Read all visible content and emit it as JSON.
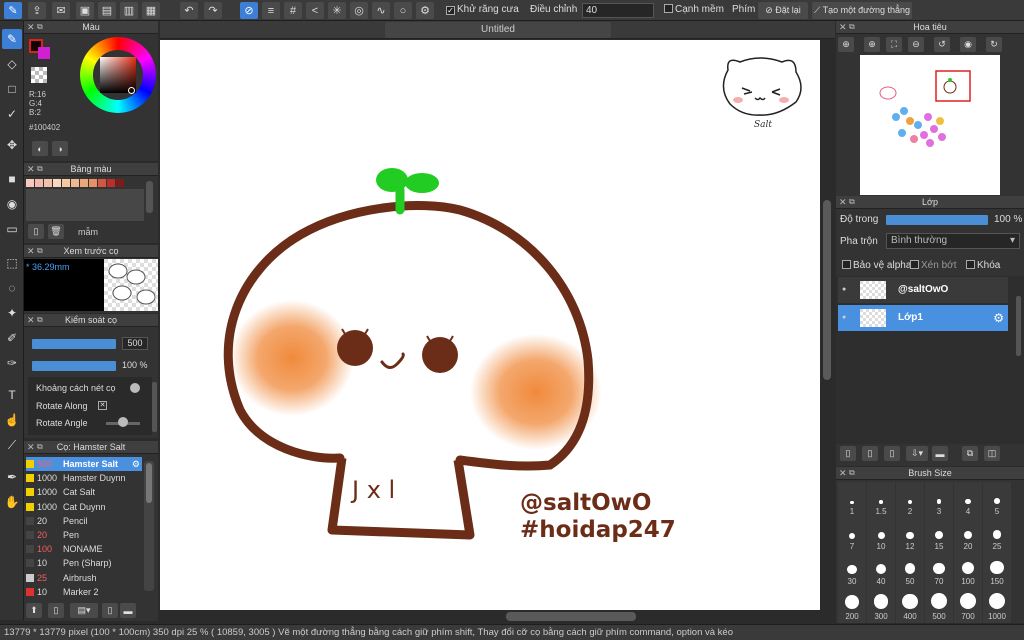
{
  "toolbar": {
    "antialias_label": "Khử răng cưa",
    "adjust_label": "Điều chỉnh",
    "adjust_value": "40",
    "edge_label": "Cạnh mềm",
    "key_label": "Phím",
    "reset_label": "Đặt lại",
    "straight_line_label": "Tạo một đường thẳng"
  },
  "document": {
    "tab_title": "Untitled"
  },
  "color_panel": {
    "title": "Màu",
    "r": "R:16",
    "g": "G:4",
    "b": "B:2",
    "hex": "#100402"
  },
  "palette_panel": {
    "title": "Bảng màu",
    "sub_label": "mẫm"
  },
  "brush_preview_panel": {
    "title": "Xem trước cọ",
    "size_value": "* 36.29mm"
  },
  "brush_control_panel": {
    "title": "Kiểm soát cọ",
    "size_value": "500",
    "opacity_value": "100 %",
    "spacing_label": "Khoảng cách nét cọ",
    "rotate_along_label": "Rotate Along",
    "rotate_angle_label": "Rotate Angle"
  },
  "brush_list_panel": {
    "title": "Cọ: Hamster Salt",
    "items": [
      {
        "size": "500",
        "name": "Hamster Salt",
        "color": "#f0d000",
        "selected": true
      },
      {
        "size": "1000",
        "name": "Hamster Duynn",
        "color": "#f0d000",
        "selected": false
      },
      {
        "size": "1000",
        "name": "Cat Salt",
        "color": "#f0d000",
        "selected": false
      },
      {
        "size": "1000",
        "name": "Cat Duynn",
        "color": "#f0d000",
        "selected": false
      },
      {
        "size": "20",
        "name": "Pencil",
        "color": "#444444",
        "selected": false
      },
      {
        "size": "20",
        "name": "Pen",
        "color": "#444444",
        "selected": false
      },
      {
        "size": "100",
        "name": "NONAME",
        "color": "#444444",
        "selected": false
      },
      {
        "size": "10",
        "name": "Pen (Sharp)",
        "color": "#444444",
        "selected": false
      },
      {
        "size": "25",
        "name": "Airbrush",
        "color": "#cccccc",
        "selected": false
      },
      {
        "size": "10",
        "name": "Marker 2",
        "color": "#e03030",
        "selected": false
      }
    ]
  },
  "navigator_panel": {
    "title": "Hoa tiêu"
  },
  "layer_panel": {
    "title": "Lớp",
    "opacity_label": "Độ trong",
    "opacity_value": "100 %",
    "blend_label": "Pha trộn",
    "blend_value": "Bình thường",
    "protect_alpha_label": "Bảo vệ alpha",
    "clipping_label": "Xén bớt",
    "lock_label": "Khóa",
    "layers": [
      {
        "name": "@saltOwO",
        "selected": false
      },
      {
        "name": "Lớp1",
        "selected": true
      }
    ]
  },
  "brush_size_panel": {
    "title": "Brush Size",
    "sizes": [
      "1",
      "1.5",
      "2",
      "3",
      "4",
      "5",
      "7",
      "10",
      "12",
      "15",
      "20",
      "25",
      "30",
      "40",
      "50",
      "70",
      "100",
      "150",
      "200",
      "300",
      "400",
      "500",
      "700",
      "1000"
    ]
  },
  "canvas": {
    "watermark_signature": "Salt",
    "face_text": "J x l",
    "credit_line1": "@saltOwO",
    "credit_line2": "#hoidap247",
    "brown": "#6b2d17",
    "blush": "#f08a3c",
    "sprout": "#22cc22"
  },
  "statusbar": {
    "text": "13779 * 13779 pixel  (100 * 100cm)   350 dpi   25 %   ( 10859, 3005 )   Vẽ một đường thẳng bằng cách giữ phím shift, Thay đổi cỡ cọ bằng cách giữ phím command, option và kéo"
  }
}
